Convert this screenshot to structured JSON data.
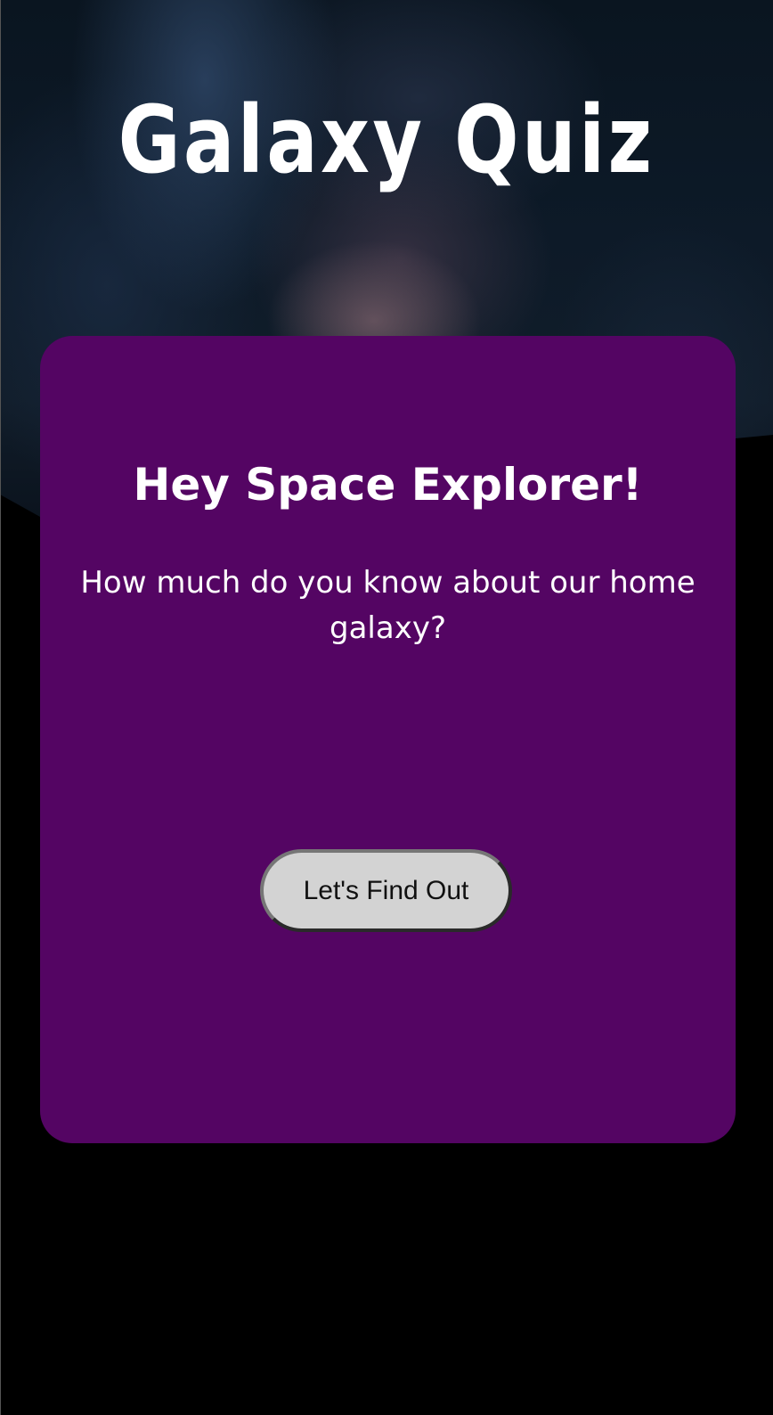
{
  "app": {
    "title": "Galaxy Quiz"
  },
  "intro_card": {
    "heading": "Hey Space Explorer!",
    "subheading": "How much do you know about our home galaxy?",
    "start_button_label": "Let's Find Out"
  },
  "colors": {
    "page_background": "#000000",
    "card_background": "#540563",
    "text": "#ffffff",
    "button_background": "#d3d3d3",
    "button_text": "#111111"
  }
}
